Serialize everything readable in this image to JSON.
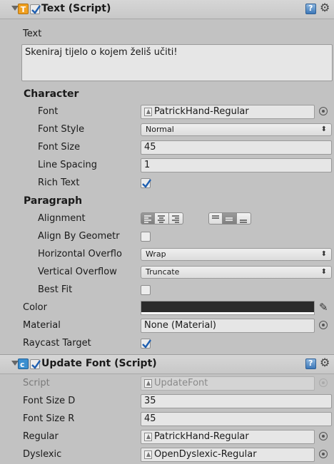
{
  "text_component": {
    "title": "Text (Script)",
    "text_label": "Text",
    "text_value": "Skeniraj tijelo o kojem želiš učiti!",
    "character_header": "Character",
    "font_label": "Font",
    "font_value": "PatrickHand-Regular",
    "font_style_label": "Font Style",
    "font_style_value": "Normal",
    "font_size_label": "Font Size",
    "font_size_value": "45",
    "line_spacing_label": "Line Spacing",
    "line_spacing_value": "1",
    "rich_text_label": "Rich Text",
    "paragraph_header": "Paragraph",
    "alignment_label": "Alignment",
    "align_by_geometry_label": "Align By Geometr",
    "horizontal_overflow_label": "Horizontal Overflo",
    "horizontal_overflow_value": "Wrap",
    "vertical_overflow_label": "Vertical Overflow",
    "vertical_overflow_value": "Truncate",
    "best_fit_label": "Best Fit",
    "color_label": "Color",
    "color_value": "#2b2b2b",
    "material_label": "Material",
    "material_value": "None (Material)",
    "raycast_target_label": "Raycast Target"
  },
  "update_font_component": {
    "title": "Update Font (Script)",
    "script_label": "Script",
    "script_value": "UpdateFont",
    "font_size_d_label": "Font Size D",
    "font_size_d_value": "35",
    "font_size_r_label": "Font Size R",
    "font_size_r_value": "45",
    "regular_label": "Regular",
    "regular_value": "PatrickHand-Regular",
    "dyslexic_label": "Dyslexic",
    "dyslexic_value": "OpenDyslexic-Regular"
  },
  "icons": {
    "text_component_icon": "T",
    "update_font_icon": "script-icon"
  },
  "colors": {
    "text_icon": "#f0a020",
    "script_icon": "#3a8fd0",
    "check": "#1f5fb0"
  }
}
